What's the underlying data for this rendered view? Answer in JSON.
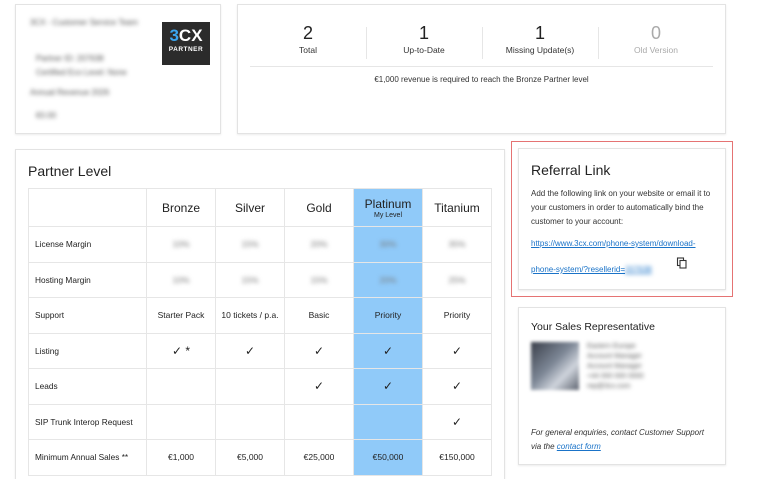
{
  "account": {
    "company": "3CX - Customer Service Team",
    "partner_id": "Partner ID: 207638",
    "reseller_code": "Certified Eco Level: None",
    "annual_revenue_label": "Annual Revenue 2026",
    "annual_revenue_value": "€0.00",
    "logo_text_a": "3",
    "logo_text_b": "CX",
    "logo_sub": "PARTNER"
  },
  "stats": [
    {
      "value": "2",
      "label": "Total"
    },
    {
      "value": "1",
      "label": "Up-to-Date"
    },
    {
      "value": "1",
      "label": "Missing Update(s)"
    },
    {
      "value": "0",
      "label": "Old Version"
    }
  ],
  "revenue_note": "€1,000 revenue is required to reach the Bronze Partner level",
  "partner": {
    "title": "Partner Level",
    "levels": [
      "Bronze",
      "Silver",
      "Gold",
      "Platinum",
      "Titanium"
    ],
    "my_level_tag": "My Level",
    "rows": [
      {
        "label": "License Margin",
        "cells": [
          "10%",
          "15%",
          "20%",
          "30%",
          "35%"
        ],
        "blurred": true
      },
      {
        "label": "Hosting Margin",
        "cells": [
          "10%",
          "15%",
          "15%",
          "20%",
          "25%"
        ],
        "blurred": true
      },
      {
        "label": "Support",
        "cells": [
          "Starter Pack",
          "10 tickets / p.a.",
          "Basic",
          "Priority",
          "Priority"
        ]
      },
      {
        "label": "Listing",
        "cells": [
          "✓ *",
          "✓",
          "✓",
          "✓",
          "✓"
        ]
      },
      {
        "label": "Leads",
        "cells": [
          "",
          "",
          "✓",
          "✓",
          "✓"
        ]
      },
      {
        "label": "SIP Trunk Interop Request",
        "cells": [
          "",
          "",
          "",
          "",
          "✓"
        ]
      },
      {
        "label": "Minimum Annual Sales **",
        "cells": [
          "€1,000",
          "€5,000",
          "€25,000",
          "€50,000",
          "€150,000"
        ]
      }
    ]
  },
  "referral": {
    "title": "Referral Link",
    "text": "Add the following link on your website or email it to your customers in order to automatically bind the customer to your account:",
    "link_line1": "https://www.3cx.com/phone-system/download-",
    "link_line2_visible": "phone-system/?resellerid=",
    "link_line2_hidden": "207638"
  },
  "sales": {
    "title": "Your Sales Representative",
    "rep_lines": [
      "Eastern Europe",
      "Account Manager",
      "Account Manager",
      "+44 000 000 0000",
      "rep@3cx.com"
    ],
    "note_prefix": "For general enquiries, contact Customer Support via the ",
    "note_link": "contact form"
  }
}
